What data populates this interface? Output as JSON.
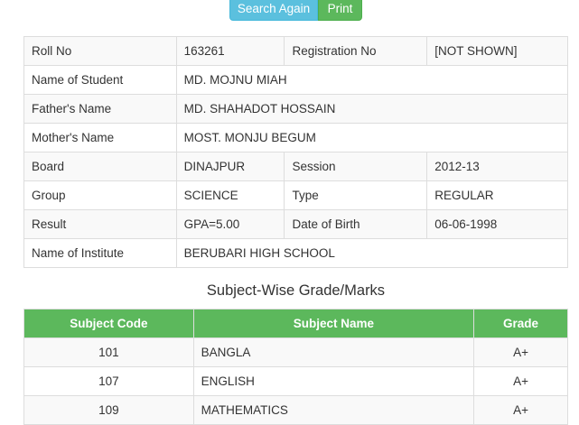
{
  "buttons": {
    "search_again": "Search Again",
    "print": "Print"
  },
  "student_info": {
    "roll_label": "Roll No",
    "roll_value": "163261",
    "reg_label": "Registration No",
    "reg_value": "[NOT SHOWN]",
    "name_label": "Name of Student",
    "name_value": "MD. MOJNU MIAH",
    "father_label": "Father's Name",
    "father_value": "MD. SHAHADOT HOSSAIN",
    "mother_label": "Mother's Name",
    "mother_value": "MOST. MONJU BEGUM",
    "board_label": "Board",
    "board_value": "DINAJPUR",
    "session_label": "Session",
    "session_value": "2012-13",
    "group_label": "Group",
    "group_value": "SCIENCE",
    "type_label": "Type",
    "type_value": "REGULAR",
    "result_label": "Result",
    "result_value": "GPA=5.00",
    "dob_label": "Date of Birth",
    "dob_value": "06-06-1998",
    "institute_label": "Name of Institute",
    "institute_value": "BERUBARI HIGH SCHOOL"
  },
  "grades": {
    "caption": "Subject-Wise Grade/Marks",
    "headers": [
      "Subject Code",
      "Subject Name",
      "Grade"
    ],
    "rows": [
      {
        "code": "101",
        "name": "BANGLA",
        "grade": "A+"
      },
      {
        "code": "107",
        "name": "ENGLISH",
        "grade": "A+"
      },
      {
        "code": "109",
        "name": "MATHEMATICS",
        "grade": "A+"
      }
    ]
  },
  "colors": {
    "info": "#5bc0de",
    "success": "#5cb85c"
  }
}
